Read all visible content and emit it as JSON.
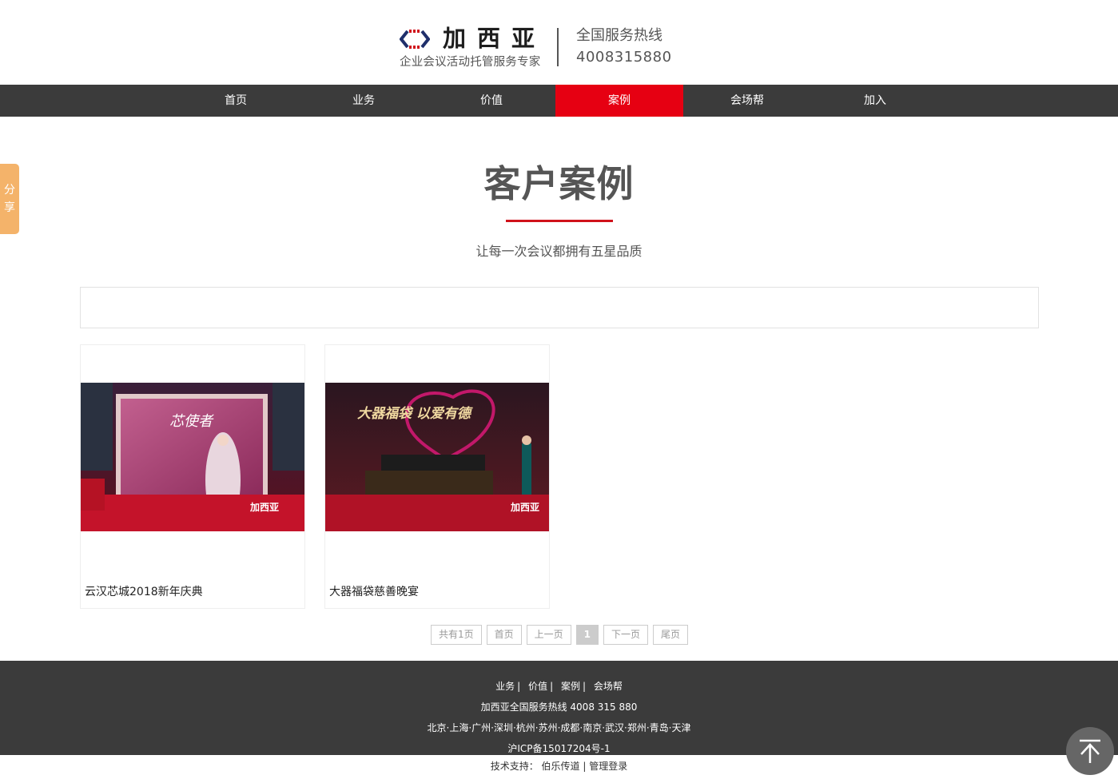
{
  "header": {
    "logo_name": "加西亚",
    "logo_tagline": "企业会议活动托管服务专家",
    "hotline_label": "全国服务热线",
    "hotline_number": "4008315880"
  },
  "nav": {
    "items": [
      {
        "label": "首页"
      },
      {
        "label": "业务"
      },
      {
        "label": "价值"
      },
      {
        "label": "案例"
      },
      {
        "label": "会场帮"
      },
      {
        "label": "加入"
      }
    ],
    "active_index": 3
  },
  "share": {
    "label": "分享"
  },
  "section": {
    "title": "客户案例",
    "subtitle": "让每一次会议都拥有五星品质"
  },
  "cases": [
    {
      "title": "云汉芯城2018新年庆典",
      "image_banner": "芯使者",
      "image_logo": "加西亚"
    },
    {
      "title": "大器福袋慈善晚宴",
      "image_banner": "大器福袋 以爱有德",
      "image_logo": "加西亚"
    }
  ],
  "pagination": {
    "total": "共有1页",
    "first": "首页",
    "prev": "上一页",
    "current": "1",
    "next": "下一页",
    "last": "尾页"
  },
  "footer": {
    "links": [
      "业务",
      "价值",
      "案例",
      "会场帮"
    ],
    "hotline": "加西亚全国服务热线 4008 315 880",
    "cities": "北京·上海·广州·深圳·杭州·苏州·成都·南京·武汉·郑州·青岛·天津",
    "icp": "沪ICP备15017204号-1",
    "support_label": "技术支持：",
    "support_link": "伯乐传道",
    "admin_link": "管理登录"
  },
  "colors": {
    "accent": "#e60012",
    "nav_bg": "#3b3b3b",
    "share_bg": "#f4b36a"
  },
  "icons": {
    "back_to_top": "arrow-up-icon",
    "logo_mark": "logo-mark-icon"
  }
}
